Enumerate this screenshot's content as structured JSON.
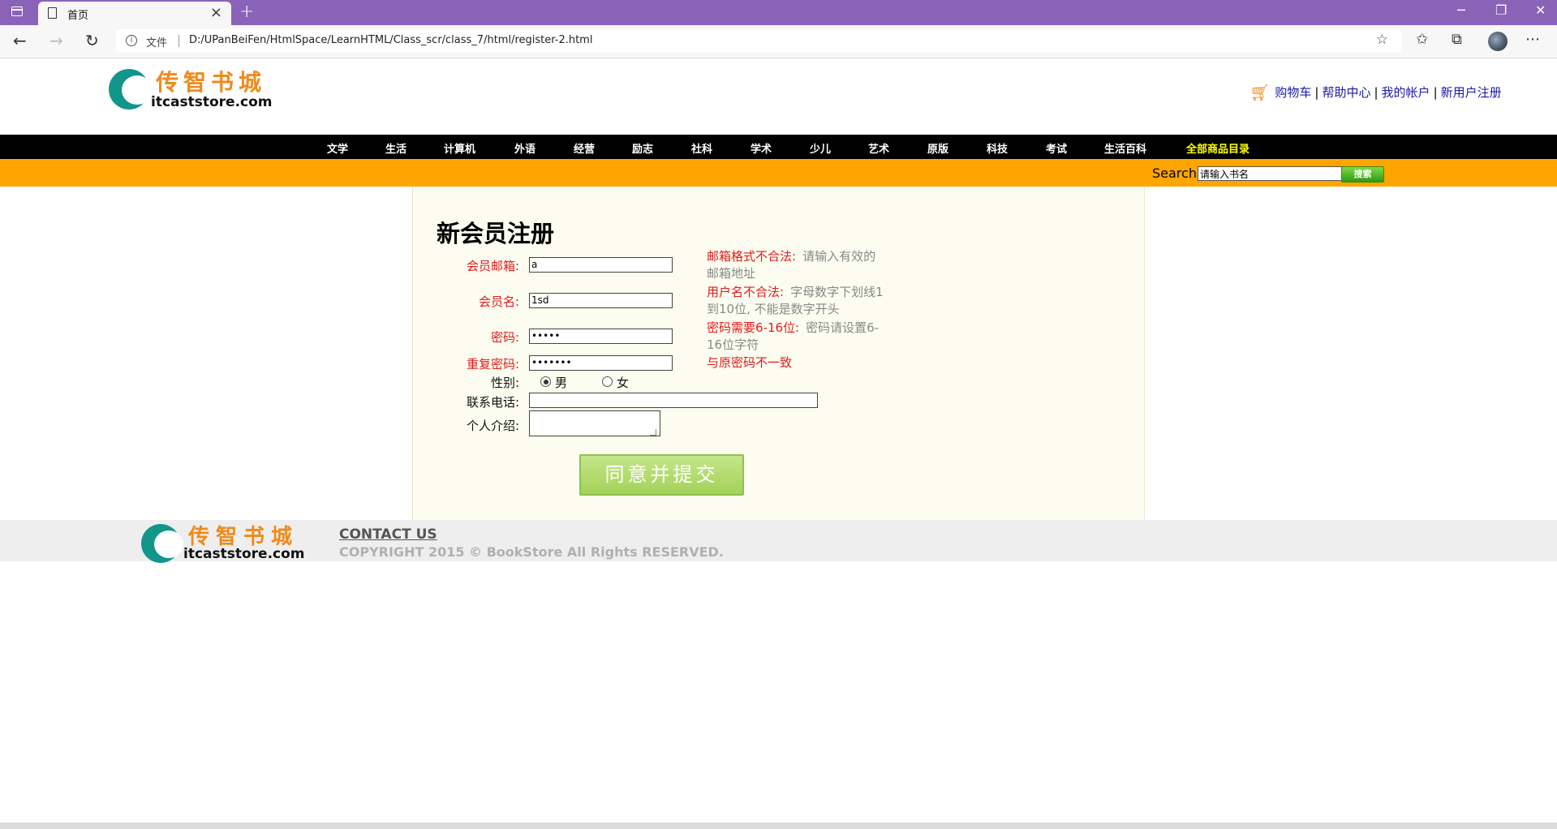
{
  "browser": {
    "tab_title": "首页",
    "address_prefix": "文件",
    "url": "D:/UPanBeiFen/HtmlSpace/LearnHTML/Class_scr/class_7/html/register-2.html",
    "accent_color": "#8a63b8"
  },
  "header": {
    "logo_cn": "传智书城",
    "logo_en": "itcaststore.com",
    "links": [
      "购物车",
      "帮助中心",
      "我的帐户",
      "新用户注册"
    ],
    "link_color": "#1a1aa6"
  },
  "categories": [
    "文学",
    "生活",
    "计算机",
    "外语",
    "经营",
    "励志",
    "社科",
    "学术",
    "少儿",
    "艺术",
    "原版",
    "科技",
    "考试",
    "生活百科",
    "全部商品目录"
  ],
  "search": {
    "label": "Search",
    "input_value": "请输入书名",
    "button_label": "搜索",
    "bar_color": "#ffa500"
  },
  "form": {
    "title": "新会员注册",
    "fields": [
      {
        "label": "会员邮箱:",
        "value": "a",
        "error_label": "邮箱格式不合法:",
        "hint": "请输入有效的邮箱地址"
      },
      {
        "label": "会员名:",
        "value": "1sd",
        "error_label": "用户名不合法:",
        "hint": "字母数字下划线1到10位, 不能是数字开头"
      },
      {
        "label": "密码:",
        "value": "•••••",
        "error_label": "密码需要6-16位:",
        "hint": "密码请设置6-16位字符"
      },
      {
        "label": "重复密码:",
        "value": "•••••••",
        "error_label": "与原密码不一致",
        "hint": ""
      }
    ],
    "gender_label": "性别:",
    "gender_options": [
      "男",
      "女"
    ],
    "gender_selected": "男",
    "phone_label": "联系电话:",
    "phone_value": "",
    "intro_label": "个人介绍:",
    "intro_value": "",
    "submit_label": "同意并提交",
    "error_color": "#e01b1b"
  },
  "footer": {
    "logo_cn": "传智书城",
    "logo_en": "itcaststore.com",
    "contact": "CONTACT US",
    "copyright": "COPYRIGHT 2015 © BookStore All Rights RESERVED."
  }
}
